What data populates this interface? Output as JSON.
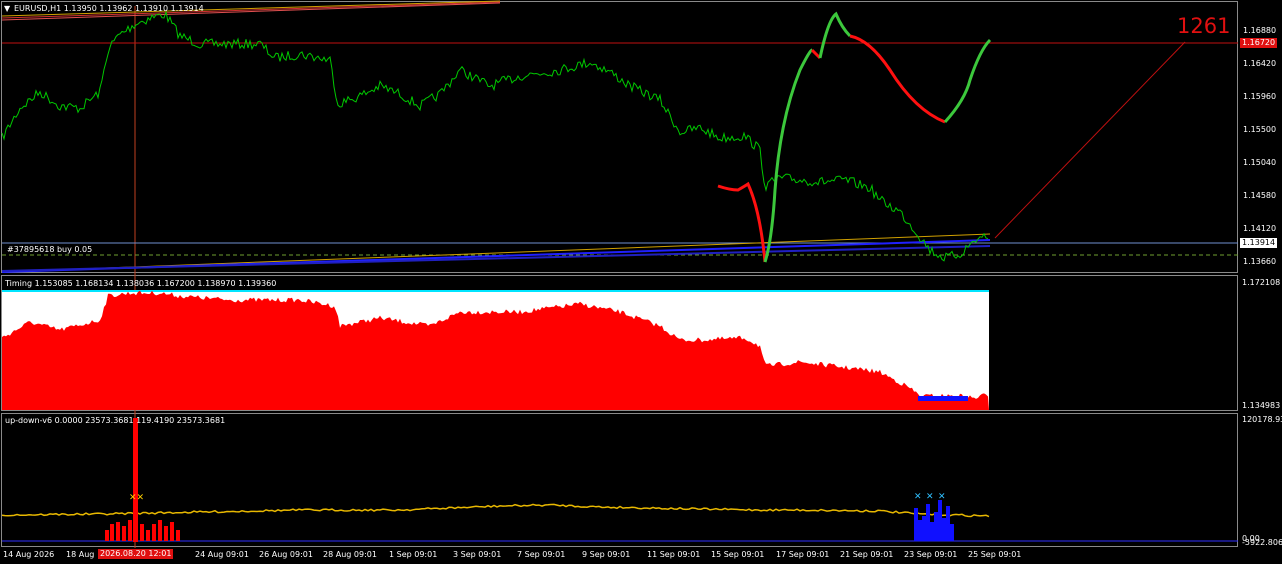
{
  "symbol_header": "EURUSD,H1  1.13950 1.13962 1.13910 1.13914",
  "order_label": "#37895618 buy 0.05",
  "big_label": "1261",
  "main_price_axis": [
    "1.16880",
    "1.16420",
    "1.15960",
    "1.15500",
    "1.15040",
    "1.14580",
    "1.14120",
    "1.13660"
  ],
  "current_price_tag": "1.13914",
  "red_line_price_tag": "1.16720",
  "timing_header": "Timing 1.153085 1.168134 1.138036 1.167200 1.138970 1.139360",
  "timing_axis": [
    "1.172108",
    "1.134983"
  ],
  "updown_header": "up-down-v6 0.0000 23573.3681 119.4190 23573.3681",
  "updown_axis_top": "120178.93",
  "updown_axis_bottom": "-5922.8064",
  "updown_axis_zero": "0.00",
  "time_axis": [
    "14 Aug 2026",
    "18 Aug",
    "24 Aug 09:01",
    "26 Aug 09:01",
    "28 Aug 09:01",
    "1 Sep 09:01",
    "3 Sep 09:01",
    "7 Sep 09:01",
    "9 Sep 09:01",
    "11 Sep 09:01",
    "15 Sep 09:01",
    "17 Sep 09:01",
    "21 Sep 09:01",
    "23 Sep 09:01",
    "25 Sep 09:01"
  ],
  "crosshair_time_tag": "2026.08.20 12:01",
  "colors": {
    "bull": "#00c800",
    "forecast_up": "#3cc83c",
    "forecast_down": "#ff1010",
    "grid": "#8a8a8a",
    "timing_fill": "#ff0000",
    "updown_line": "#e8b800",
    "blue": "#1010ff"
  }
}
